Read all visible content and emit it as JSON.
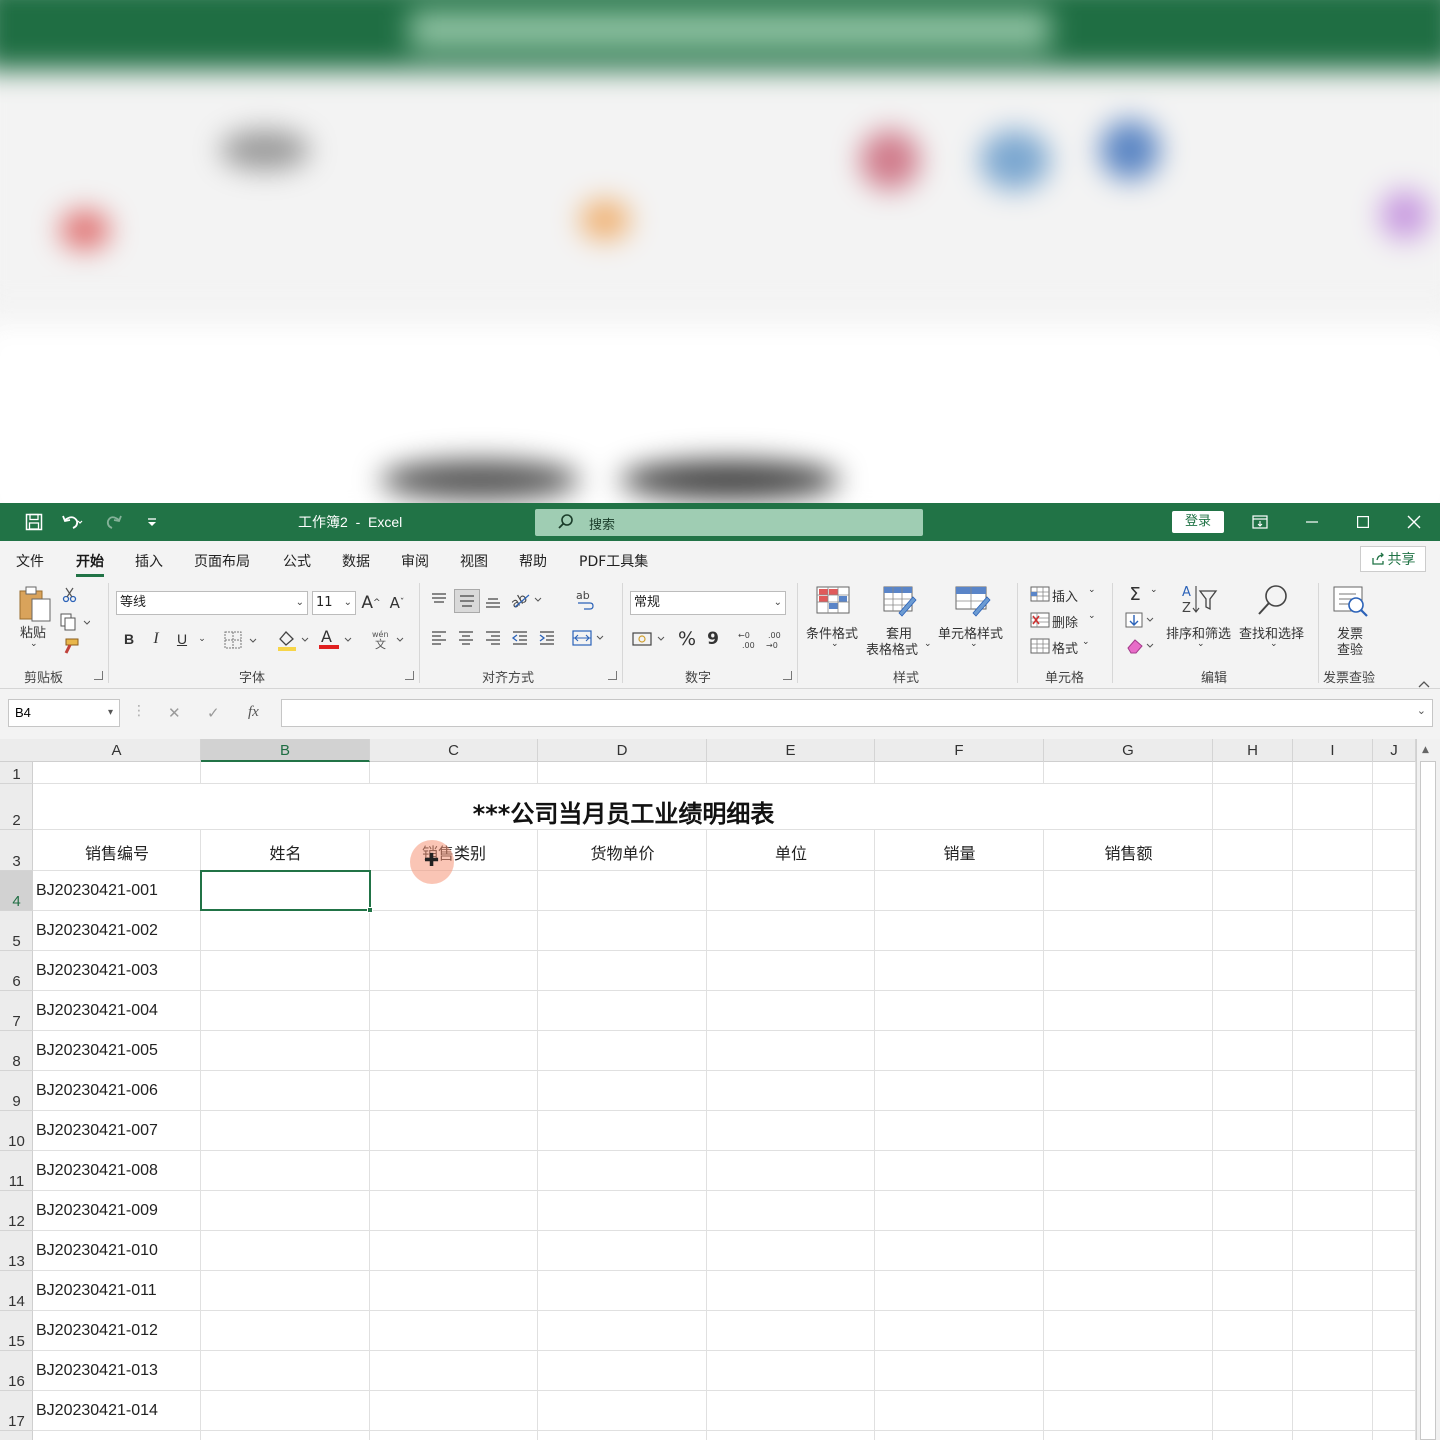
{
  "titlebar": {
    "doc_title": "工作簿2  -  Excel",
    "search_label": "搜索",
    "login_label": "登录"
  },
  "menu": {
    "tabs": [
      "文件",
      "开始",
      "插入",
      "页面布局",
      "公式",
      "数据",
      "审阅",
      "视图",
      "帮助",
      "PDF工具集"
    ],
    "active_tab": "开始",
    "share_label": "共享"
  },
  "ribbon": {
    "clipboard": {
      "paste_label": "粘贴",
      "group_label": "剪贴板"
    },
    "font": {
      "font_name": "等线",
      "font_size": "11",
      "group_label": "字体",
      "bold": "B",
      "italic": "I",
      "underline": "U",
      "grow": "A",
      "shrink": "A",
      "font_color_glyph": "A",
      "phonetic": "wén"
    },
    "alignment": {
      "group_label": "对齐方式"
    },
    "number": {
      "format": "常规",
      "group_label": "数字",
      "percent": "%",
      "comma": "9"
    },
    "styles": {
      "conditional": "条件格式",
      "table_format_1": "套用",
      "table_format_2": "表格格式",
      "cell_styles": "单元格样式",
      "group_label": "样式"
    },
    "cells": {
      "insert": "插入",
      "delete": "删除",
      "format": "格式",
      "group_label": "单元格"
    },
    "editing": {
      "sort_filter": "排序和筛选",
      "find_select": "查找和选择",
      "group_label": "编辑",
      "sum_glyph": "Σ"
    },
    "invoice": {
      "label_1": "发票",
      "label_2": "查验",
      "group_label": "发票查验"
    }
  },
  "formula_bar": {
    "name_box": "B4",
    "fx": "fx",
    "formula": ""
  },
  "sheet": {
    "columns": [
      "A",
      "B",
      "C",
      "D",
      "E",
      "F",
      "G",
      "H",
      "I",
      "J"
    ],
    "selected_column": "B",
    "rows": [
      "1",
      "2",
      "3",
      "4",
      "5",
      "6",
      "7",
      "8",
      "9",
      "10",
      "11",
      "12",
      "13",
      "14",
      "15",
      "16",
      "17"
    ],
    "selected_row": "4",
    "title": "***公司当月员工业绩明细表",
    "headers": [
      "销售编号",
      "姓名",
      "销售类别",
      "货物单价",
      "单位",
      "销量",
      "销售额"
    ],
    "ids": [
      "BJ20230421-001",
      "BJ20230421-002",
      "BJ20230421-003",
      "BJ20230421-004",
      "BJ20230421-005",
      "BJ20230421-006",
      "BJ20230421-007",
      "BJ20230421-008",
      "BJ20230421-009",
      "BJ20230421-010",
      "BJ20230421-011",
      "BJ20230421-012",
      "BJ20230421-013",
      "BJ20230421-014"
    ],
    "active_cell": "B4"
  },
  "colors": {
    "accent": "#217346",
    "ribbon_bg": "#f3f3f3",
    "cursor_highlight": "#f59678"
  }
}
